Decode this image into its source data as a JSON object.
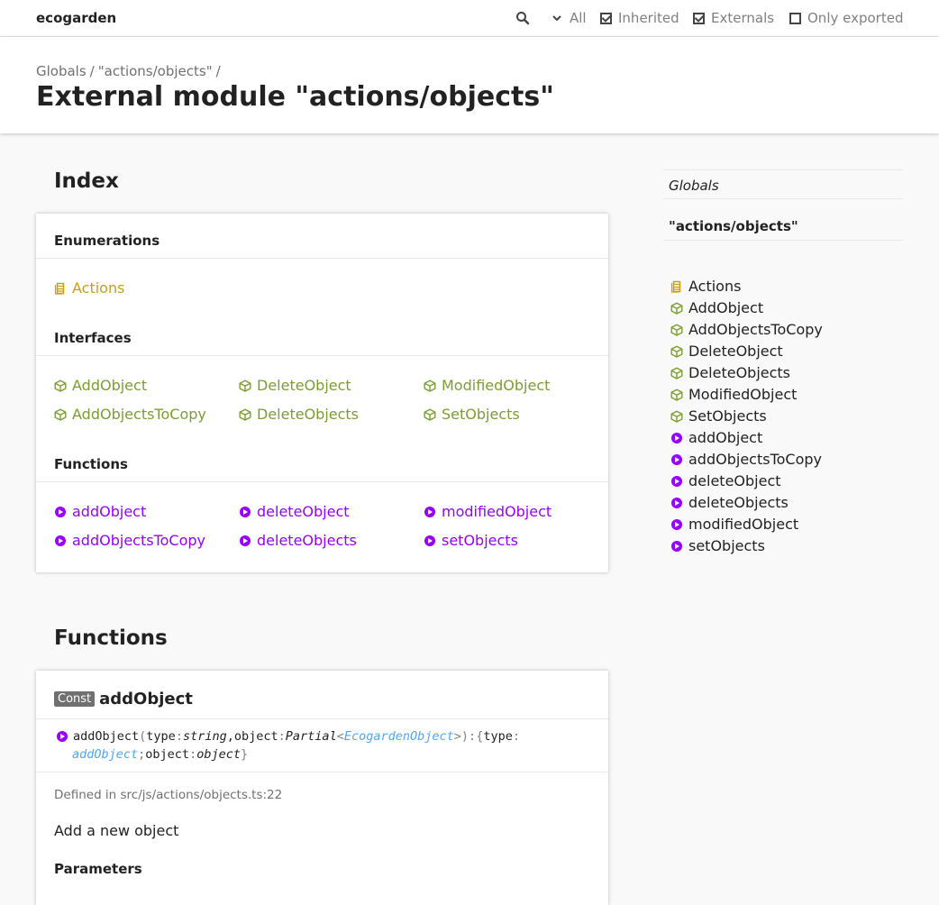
{
  "header": {
    "brand": "ecogarden",
    "search_icon": "search-icon",
    "visibility_label": "All",
    "filters": [
      {
        "label": "Inherited",
        "checked": true
      },
      {
        "label": "Externals",
        "checked": true
      },
      {
        "label": "Only exported",
        "checked": false
      }
    ]
  },
  "breadcrumb": {
    "items": [
      "Globals",
      "\"actions/objects\""
    ],
    "separator": "/"
  },
  "page_title": "External module \"actions/objects\"",
  "index": {
    "title": "Index",
    "sections": [
      {
        "heading": "Enumerations",
        "kind": "enumeration",
        "items": [
          "Actions"
        ]
      },
      {
        "heading": "Interfaces",
        "kind": "interface",
        "items": [
          "AddObject",
          "DeleteObject",
          "ModifiedObject",
          "AddObjectsToCopy",
          "DeleteObjects",
          "SetObjects"
        ]
      },
      {
        "heading": "Functions",
        "kind": "function",
        "items": [
          "addObject",
          "deleteObject",
          "modifiedObject",
          "addObjectsToCopy",
          "deleteObjects",
          "setObjects"
        ]
      }
    ]
  },
  "sidebar": {
    "globals_label": "Globals",
    "module_label": "\"actions/objects\"",
    "items": [
      {
        "label": "Actions",
        "kind": "enumeration"
      },
      {
        "label": "AddObject",
        "kind": "interface"
      },
      {
        "label": "AddObjectsToCopy",
        "kind": "interface"
      },
      {
        "label": "DeleteObject",
        "kind": "interface"
      },
      {
        "label": "DeleteObjects",
        "kind": "interface"
      },
      {
        "label": "ModifiedObject",
        "kind": "interface"
      },
      {
        "label": "SetObjects",
        "kind": "interface"
      },
      {
        "label": "addObject",
        "kind": "function"
      },
      {
        "label": "addObjectsToCopy",
        "kind": "function"
      },
      {
        "label": "deleteObject",
        "kind": "function"
      },
      {
        "label": "deleteObjects",
        "kind": "function"
      },
      {
        "label": "modifiedObject",
        "kind": "function"
      },
      {
        "label": "setObjects",
        "kind": "function"
      }
    ]
  },
  "functions_section": {
    "title": "Functions",
    "item": {
      "badge": "Const",
      "name": "addObject",
      "signature": {
        "name": "addObject",
        "open_paren": "(",
        "p1_name": "type",
        "colon": ":",
        "p1_type": "string",
        "comma": ",",
        "p2_name": "object",
        "p2_type": "Partial",
        "lt": "<",
        "generic": "EcogardenObject",
        "gt": ">",
        "close_paren": ")",
        "ret_open": "{",
        "r1_name": "type",
        "r1_type": "addObject",
        "semi": ";",
        "r2_name": "object",
        "r2_type": "object",
        "ret_close": "}"
      },
      "defined_in": "Defined in src/js/actions/objects.ts:22",
      "description": "Add a new object",
      "parameters_heading": "Parameters"
    }
  },
  "colors": {
    "enumeration": "#c79f17",
    "interface": "#7c9d2f",
    "function": "#9600ff",
    "type_link": "#4da6ff"
  }
}
